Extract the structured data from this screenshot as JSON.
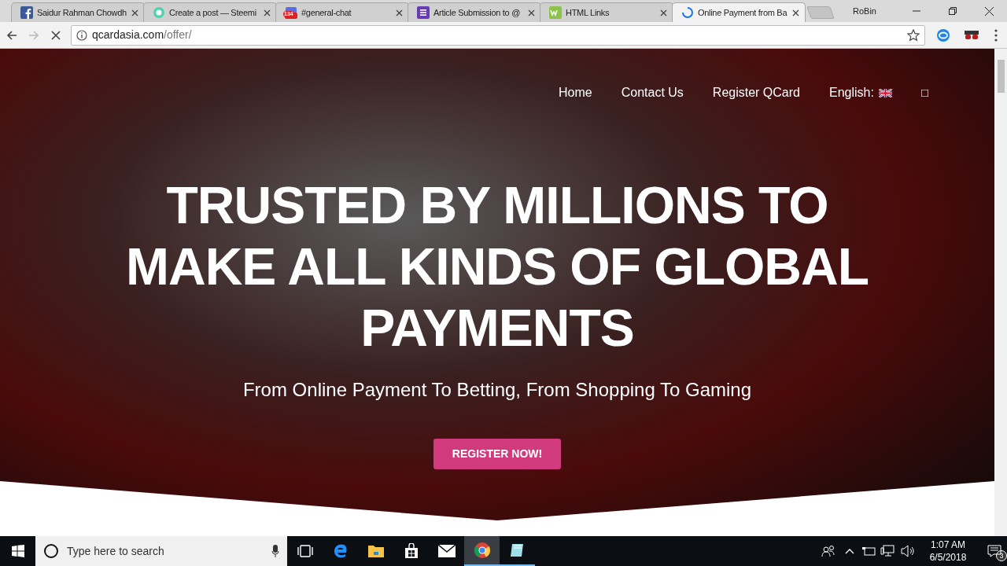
{
  "browser": {
    "tabs": [
      {
        "title": "Saidur Rahman Chowdh",
        "kind": "facebook",
        "selected": false
      },
      {
        "title": "Create a post — Steemi",
        "kind": "steemit",
        "selected": false
      },
      {
        "title": "#general-chat",
        "kind": "chat",
        "badge": "134",
        "selected": false
      },
      {
        "title": "Article Submission to @",
        "kind": "form",
        "selected": false
      },
      {
        "title": "HTML Links",
        "kind": "w3",
        "selected": false
      },
      {
        "title": "Online Payment from Ba",
        "kind": "loading",
        "selected": true
      }
    ],
    "profile": "RoBin",
    "address": {
      "host": "qcardasia.com",
      "path": "/offer/"
    }
  },
  "site": {
    "nav": [
      {
        "label": "Home",
        "kind": "link"
      },
      {
        "label": "Contact Us",
        "kind": "link"
      },
      {
        "label": "Register QCard",
        "kind": "link"
      },
      {
        "label": "English:",
        "kind": "language"
      },
      {
        "label": "□",
        "kind": "glyph"
      }
    ],
    "headline": "TRUSTED BY MILLIONS TO MAKE ALL KINDS OF GLOBAL PAYMENTS",
    "subtitle": "From Online Payment To Betting, From Shopping To Gaming",
    "cta": "REGISTER NOW!"
  },
  "taskbar": {
    "search_placeholder": "Type here to search",
    "time": "1:07 AM",
    "date": "6/5/2018",
    "notifications": "3"
  }
}
